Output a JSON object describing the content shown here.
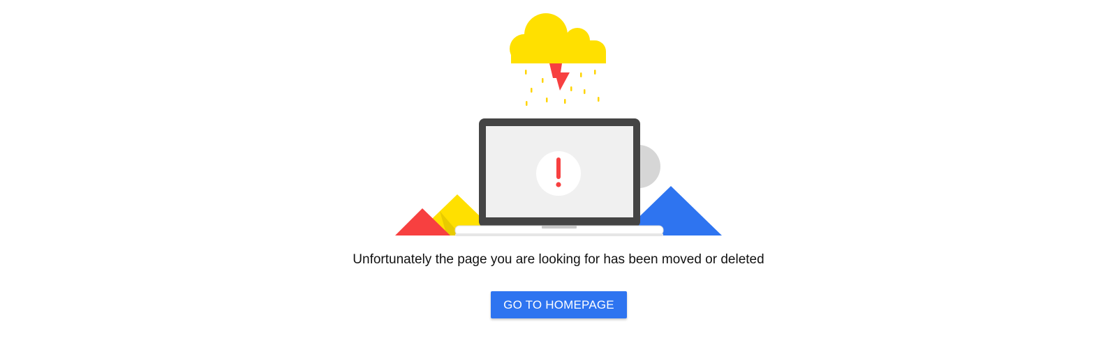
{
  "error_page": {
    "message": "Unfortunately the page you are looking for has been moved or deleted",
    "button_label": "GO TO HOMEPAGE"
  },
  "illustration": {
    "icons": [
      "cloud-icon",
      "lightning-bolt-icon",
      "rain-icon",
      "laptop-icon",
      "exclamation-icon"
    ],
    "colors": {
      "cloud": "#ffe000",
      "bolt": "#f74040",
      "red_triangle": "#f74040",
      "yellow_triangle": "#ffe000",
      "blue_triangle": "#2e74f0",
      "gray_circle": "#d6d6d6",
      "laptop_frame": "#444444",
      "laptop_screen": "#f0f0f0",
      "button": "#2e74f0"
    }
  }
}
